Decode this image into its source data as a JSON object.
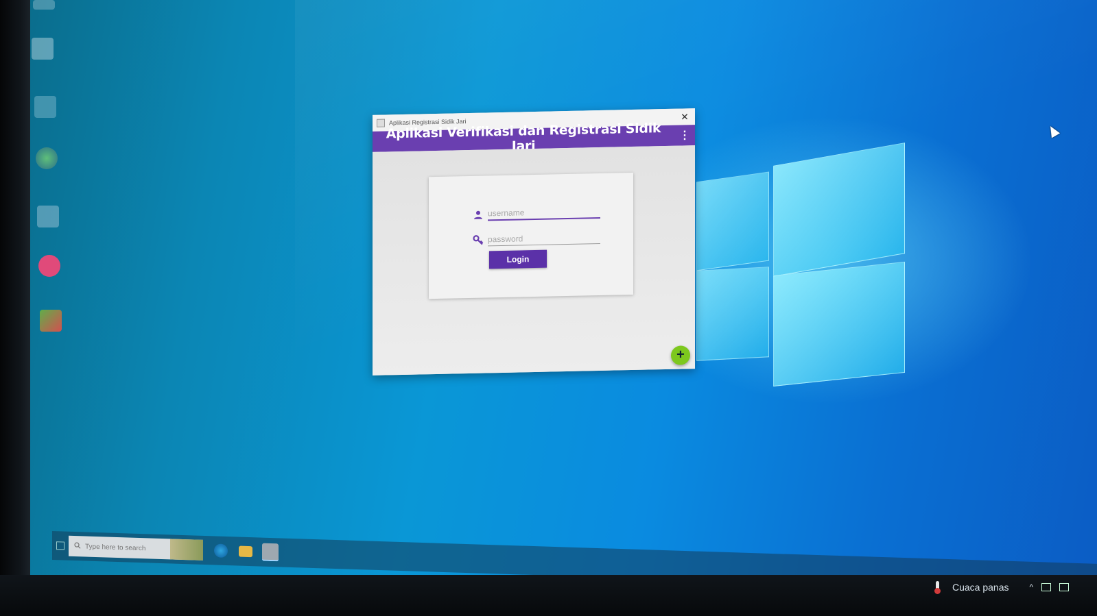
{
  "window": {
    "title": "Aplikasi Registrasi Sidik Jari",
    "close_label": "✕"
  },
  "appbar": {
    "heading": "Aplikasi Verifikasi dan Registrasi Sidik Jari",
    "menu_label": "⋮"
  },
  "login": {
    "username_placeholder": "username",
    "username_value": "",
    "password_placeholder": "password",
    "password_value": "",
    "button_label": "Login",
    "username_icon": "user-icon",
    "password_icon": "key-icon"
  },
  "fab": {
    "label": "+",
    "color": "#7dc81e"
  },
  "taskbar": {
    "search_placeholder": "Type here to search"
  },
  "tray": {
    "weather_text": "Cuaca panas",
    "chevron": "^"
  },
  "colors": {
    "accent": "#6a3fb0",
    "button": "#5b31a8",
    "desktop": "#0a8be0"
  }
}
